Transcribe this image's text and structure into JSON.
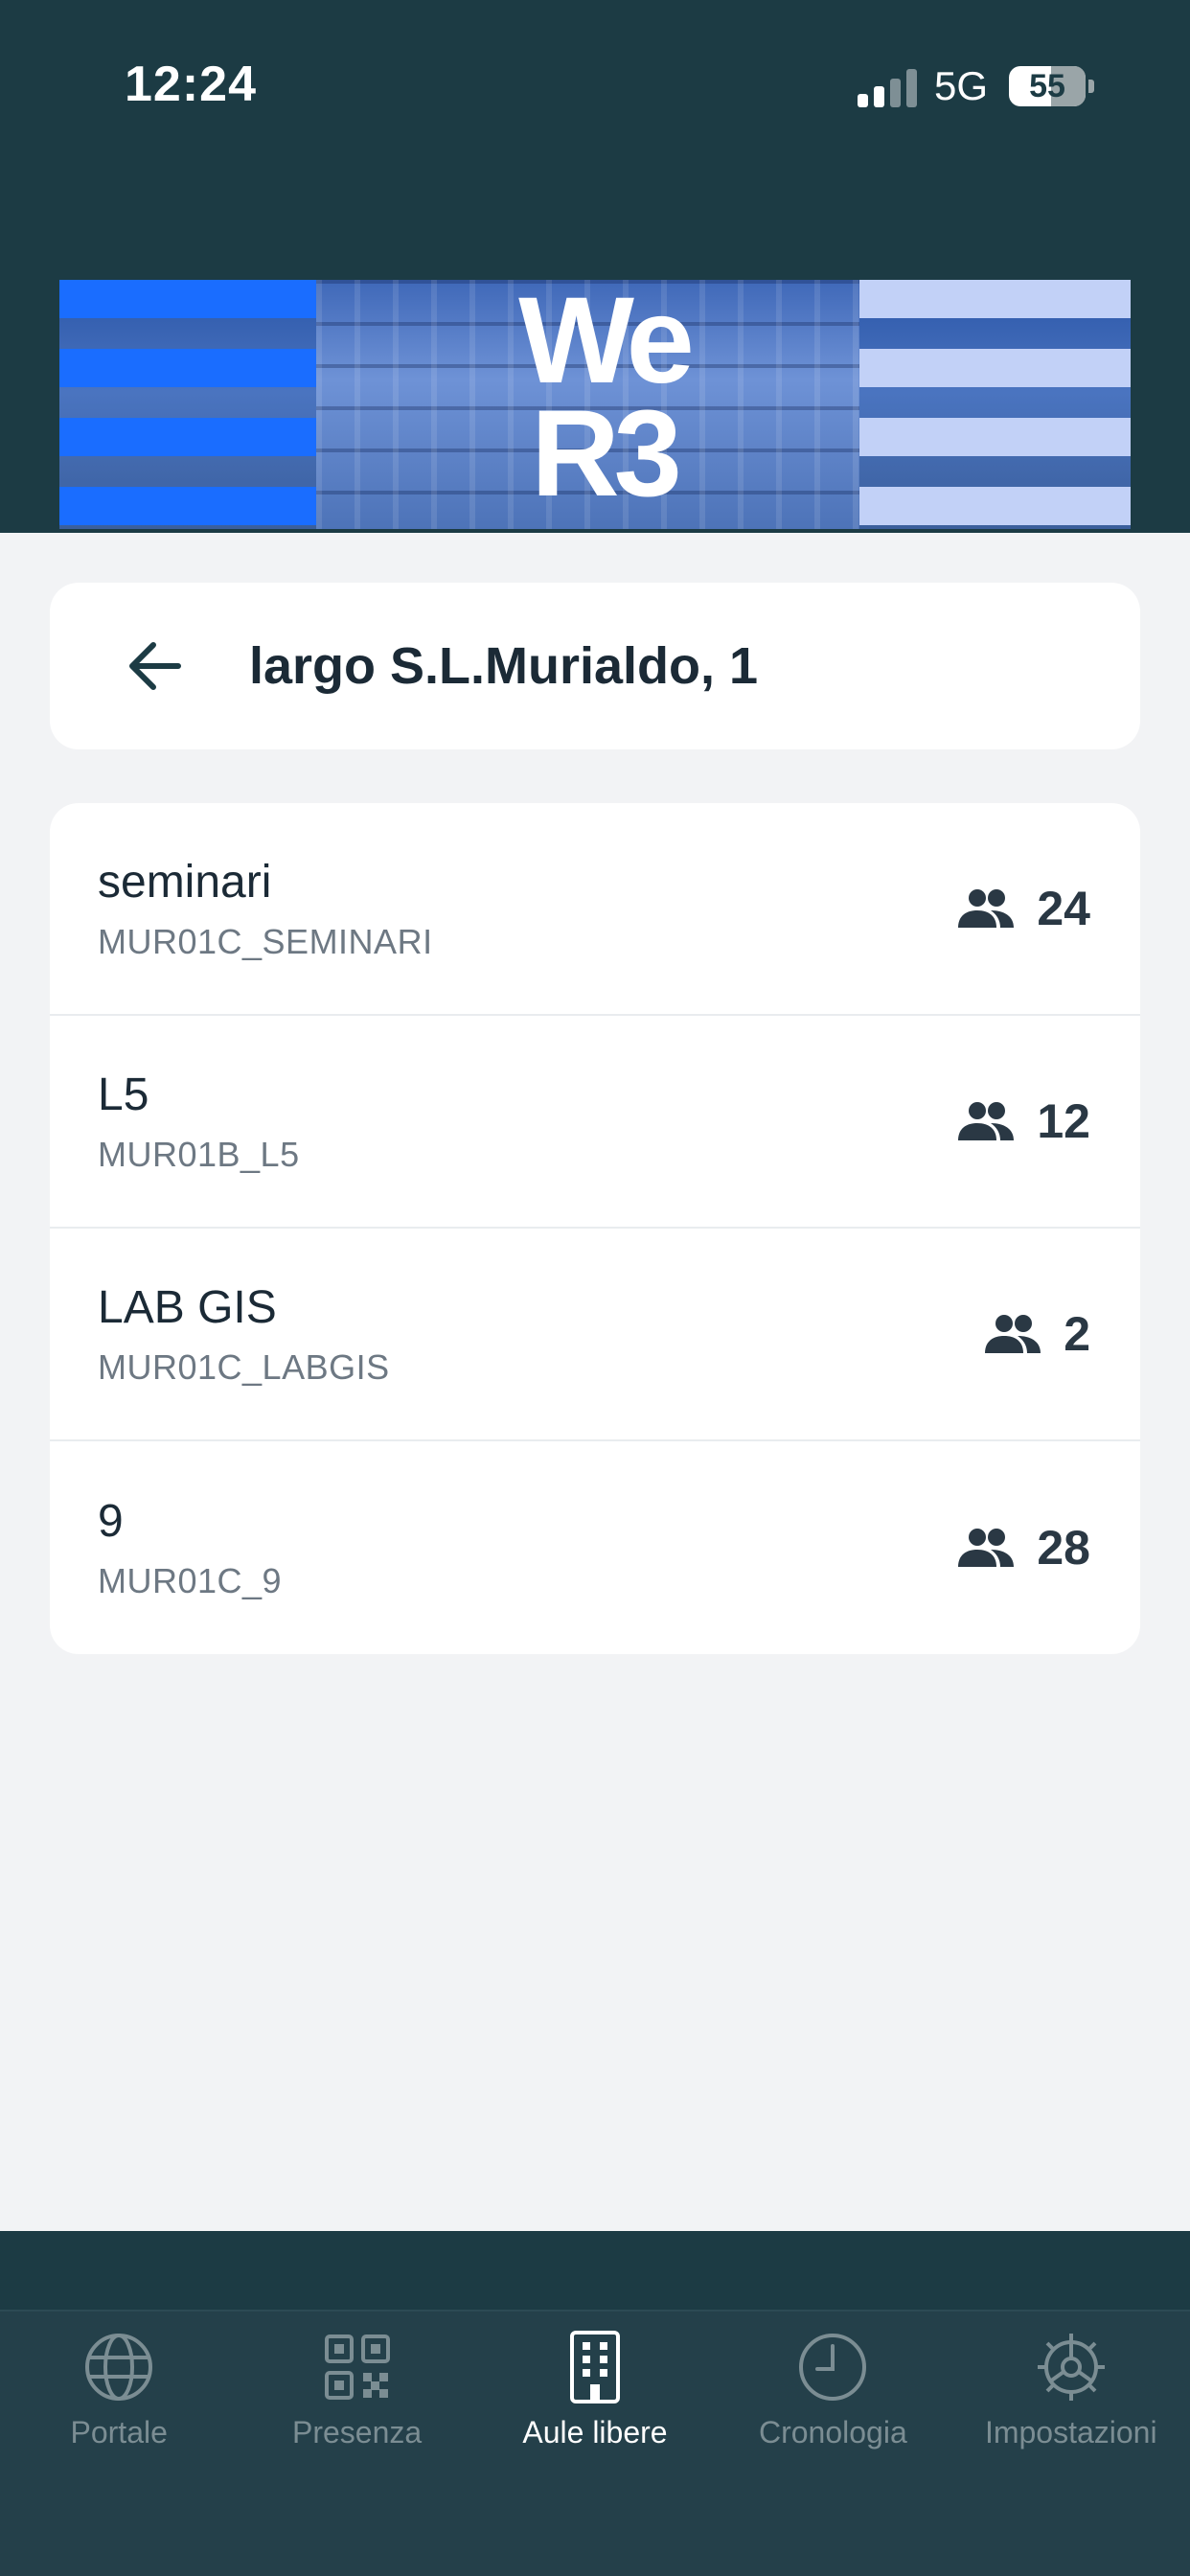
{
  "status_bar": {
    "time": "12:24",
    "network": "5G",
    "battery": "55"
  },
  "banner": {
    "logo_line1": "We",
    "logo_line2": "R3"
  },
  "header": {
    "back_icon": "arrow-left-icon",
    "title": "largo S.L.Murialdo, 1"
  },
  "rooms": [
    {
      "name": "seminari",
      "code": "MUR01C_SEMINARI",
      "capacity": "24"
    },
    {
      "name": "L5",
      "code": "MUR01B_L5",
      "capacity": "12"
    },
    {
      "name": "LAB GIS",
      "code": "MUR01C_LABGIS",
      "capacity": "2"
    },
    {
      "name": "9",
      "code": "MUR01C_9",
      "capacity": "28"
    }
  ],
  "tabs": [
    {
      "label": "Portale",
      "icon": "globe-icon",
      "active": false
    },
    {
      "label": "Presenza",
      "icon": "qr-code-icon",
      "active": false
    },
    {
      "label": "Aule libere",
      "icon": "building-icon",
      "active": true
    },
    {
      "label": "Cronologia",
      "icon": "clock-icon",
      "active": false
    },
    {
      "label": "Impostazioni",
      "icon": "gear-icon",
      "active": false
    }
  ],
  "colors": {
    "header_bg": "#1c3b44",
    "tabbar_bg": "#24404a",
    "page_bg": "#f2f3f5",
    "accent_blue": "#1a6dff"
  }
}
